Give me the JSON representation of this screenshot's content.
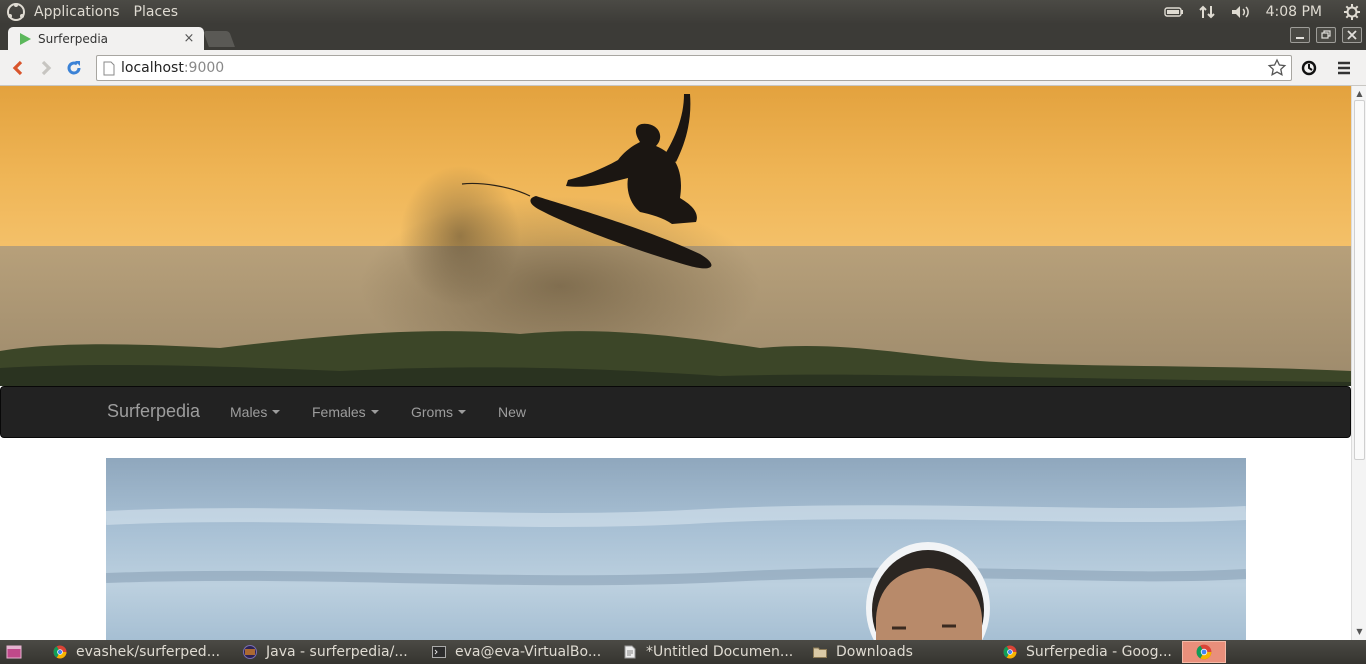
{
  "top_panel": {
    "menu": [
      "Applications",
      "Places"
    ],
    "clock": "4:08 PM"
  },
  "browser": {
    "tab_title": "Surferpedia",
    "tab_close": "×",
    "url_host": "localhost",
    "url_port": ":9000"
  },
  "site": {
    "brand": "Surferpedia",
    "nav": [
      {
        "label": "Males",
        "dropdown": true
      },
      {
        "label": "Females",
        "dropdown": true
      },
      {
        "label": "Groms",
        "dropdown": true
      },
      {
        "label": "New",
        "dropdown": false
      }
    ]
  },
  "taskbar": {
    "tasks": [
      {
        "label": "evashek/surferped...",
        "icon": "chrome-icon"
      },
      {
        "label": "Java - surferpedia/...",
        "icon": "eclipse-icon"
      },
      {
        "label": "eva@eva-VirtualBo...",
        "icon": "terminal-icon"
      },
      {
        "label": "*Untitled Documen...",
        "icon": "text-editor-icon"
      },
      {
        "label": "Downloads",
        "icon": "folder-icon"
      },
      {
        "label": "Surferpedia - Goog...",
        "icon": "chrome-icon"
      }
    ]
  },
  "colors": {
    "navbar_bg": "#222222",
    "navbar_text": "#9d9d9d",
    "panel_bg": "#3c3b37"
  }
}
